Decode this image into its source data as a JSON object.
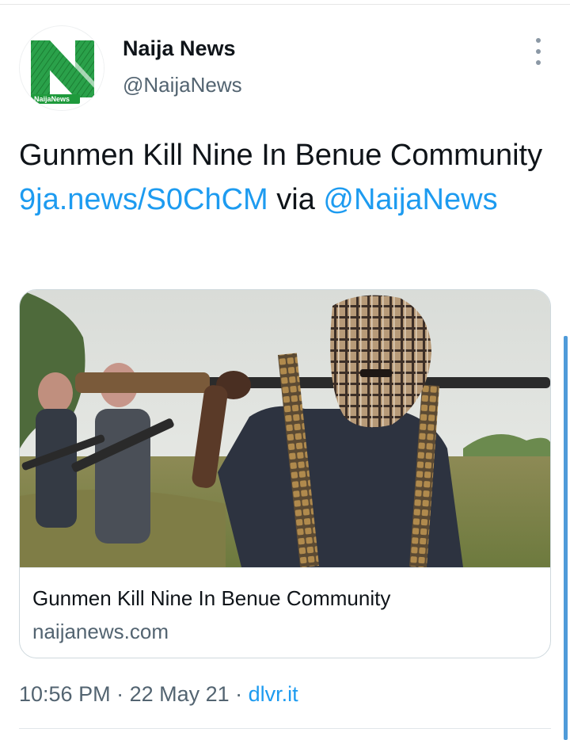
{
  "tweet": {
    "display_name": "Naija News",
    "handle": "@NaijaNews",
    "avatar_logo_text": "NaijaNews",
    "text_before_link": "Gunmen Kill Nine In Benue Community ",
    "link": "9ja.news/S0ChCM",
    "text_between": " via ",
    "mention": "@NaijaNews",
    "time": "10:56 PM",
    "separator": " · ",
    "date": "22 May 21",
    "source": "dlvr.it"
  },
  "card": {
    "title": "Gunmen Kill Nine In Benue Community",
    "domain": "naijanews.com"
  },
  "icons": {
    "more": "more-vertical-icon"
  },
  "colors": {
    "accent": "#1d9bf0",
    "secondary_text": "#536471",
    "logo_green": "#1f9a3c"
  }
}
